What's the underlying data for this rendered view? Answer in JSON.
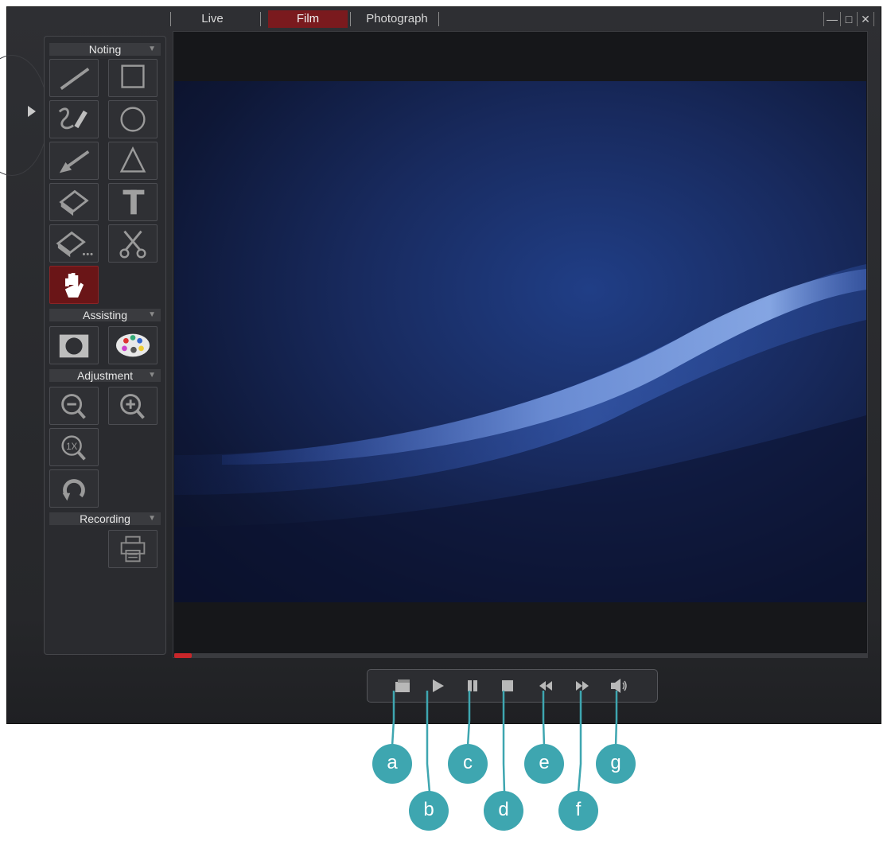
{
  "tabs": [
    {
      "label": "Live",
      "active": false
    },
    {
      "label": "Film",
      "active": true
    },
    {
      "label": "Photograph",
      "active": false
    }
  ],
  "window_controls": [
    "—",
    "□",
    "✕"
  ],
  "panel": {
    "sections": [
      {
        "label": "Noting"
      },
      {
        "label": "Assisting"
      },
      {
        "label": "Adjustment"
      },
      {
        "label": "Recording"
      }
    ],
    "noting_tools": [
      "line-icon",
      "rectangle-icon",
      "freehand-pencil-icon",
      "circle-icon",
      "arrow-icon",
      "triangle-icon",
      "eraser-icon",
      "text-icon",
      "eraser-all-icon",
      "scissors-icon",
      "hand-icon"
    ],
    "assisting_tools": [
      "mask-icon",
      "palette-icon"
    ],
    "adjustment_tools": [
      "zoom-out-icon",
      "zoom-in-icon",
      "zoom-1x-icon",
      "rotate-icon"
    ],
    "recording_tools": [
      "print-icon"
    ]
  },
  "video": {
    "progress_fraction": 0.025
  },
  "controls": [
    {
      "name": "open-folder",
      "callout": "a"
    },
    {
      "name": "play",
      "callout": "b"
    },
    {
      "name": "pause",
      "callout": "c"
    },
    {
      "name": "stop",
      "callout": "d"
    },
    {
      "name": "rewind",
      "callout": "e"
    },
    {
      "name": "fast-forward",
      "callout": "f"
    },
    {
      "name": "volume",
      "callout": "g"
    }
  ],
  "colors": {
    "accent_red": "#7a1a1e",
    "callout_teal": "#3ea6b0"
  }
}
